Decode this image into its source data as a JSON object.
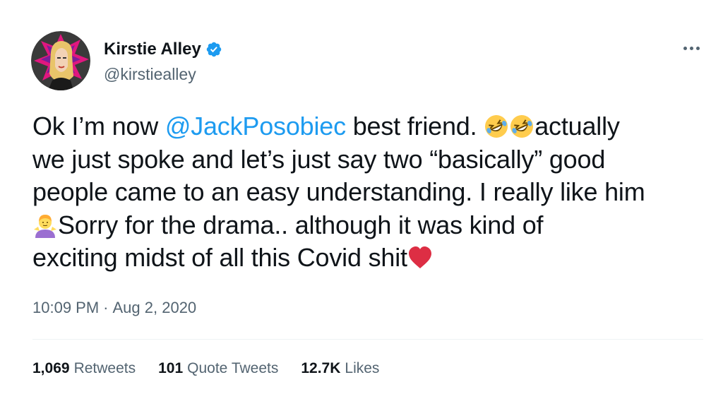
{
  "author": {
    "display_name": "Kirstie Alley",
    "handle": "@kirstiealley",
    "verified": true,
    "avatar_icon": "profile-avatar"
  },
  "header": {
    "more_icon": "more-options-icon"
  },
  "tweet": {
    "lines": [
      {
        "before": "Ok I’m now ",
        "mention": "@JackPosobiec",
        "after": " best friend. ",
        "emoji_count": 2,
        "emoji": "rolling-on-the-floor-laughing",
        "tail": "actually"
      },
      {
        "text": "we just spoke and let’s just say two “basically” good"
      },
      {
        "text": "people came to an easy understanding. I really like him"
      },
      {
        "emoji": "person-shrugging",
        "text": "Sorry for the drama.. although it was kind of"
      },
      {
        "text": "exciting midst of all this Covid shit",
        "emoji": "red-heart"
      }
    ]
  },
  "timestamp": {
    "time": "10:09 PM",
    "separator": "·",
    "date": "Aug 2, 2020"
  },
  "stats": {
    "retweets": {
      "count": "1,069",
      "label": "Retweets"
    },
    "quote_tweets": {
      "count": "101",
      "label": "Quote Tweets"
    },
    "likes": {
      "count": "12.7K",
      "label": "Likes"
    }
  },
  "colors": {
    "link": "#1d9bf0",
    "secondary_text": "#536471",
    "primary_text": "#0f1419",
    "heart": "#dd2e44"
  }
}
